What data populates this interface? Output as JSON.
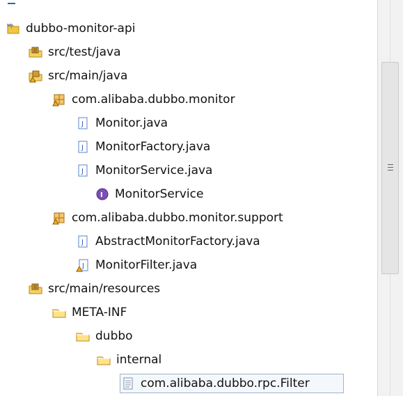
{
  "tree": {
    "items": [
      {
        "label": "dubbo-monitor-api",
        "icon": "java-project-icon"
      },
      {
        "label": "src/test/java",
        "icon": "source-folder-icon"
      },
      {
        "label": "src/main/java",
        "icon": "source-folder-warning-icon"
      },
      {
        "label": "com.alibaba.dubbo.monitor",
        "icon": "package-icon"
      },
      {
        "label": "Monitor.java",
        "icon": "java-file-icon"
      },
      {
        "label": "MonitorFactory.java",
        "icon": "java-file-icon"
      },
      {
        "label": "MonitorService.java",
        "icon": "java-file-icon"
      },
      {
        "label": "MonitorService",
        "icon": "interface-icon"
      },
      {
        "label": "com.alibaba.dubbo.monitor.support",
        "icon": "package-icon"
      },
      {
        "label": "AbstractMonitorFactory.java",
        "icon": "java-file-icon"
      },
      {
        "label": "MonitorFilter.java",
        "icon": "java-file-warning-icon"
      },
      {
        "label": "src/main/resources",
        "icon": "resource-folder-icon"
      },
      {
        "label": "META-INF",
        "icon": "folder-icon"
      },
      {
        "label": "dubbo",
        "icon": "folder-icon"
      },
      {
        "label": "internal",
        "icon": "folder-icon"
      },
      {
        "label": "com.alibaba.dubbo.rpc.Filter",
        "icon": "text-file-icon"
      }
    ]
  },
  "colors": {
    "accent": "#2f5fbf",
    "folder": "#f5c542",
    "java": "#5b83c7",
    "interface": "#7b4fb7",
    "warning": "#f2b01e"
  }
}
